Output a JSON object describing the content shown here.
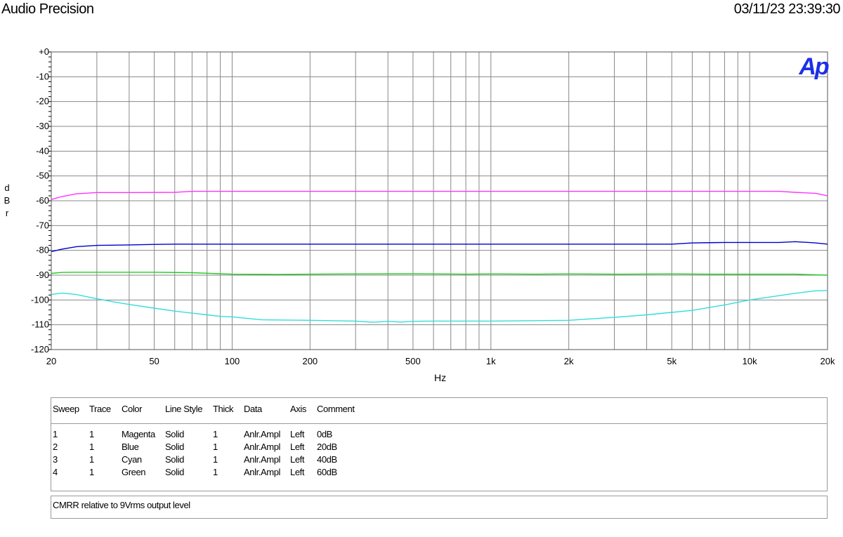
{
  "header": {
    "title": "Audio Precision",
    "timestamp": "03/11/23 23:39:30"
  },
  "logo": "Ap",
  "chart_data": {
    "type": "line",
    "xscale": "log",
    "xlim": [
      20,
      20000
    ],
    "ylim": [
      -120,
      0
    ],
    "ylabel": "dBr",
    "xlabel": "Hz",
    "grid": true,
    "y_ticks": [
      0,
      -10,
      -20,
      -30,
      -40,
      -50,
      -60,
      -70,
      -80,
      -90,
      -100,
      -110,
      -120
    ],
    "y_tick_labels": [
      "+0",
      "-10",
      "-20",
      "-30",
      "-40",
      "-50",
      "-60",
      "-70",
      "-80",
      "-90",
      "-100",
      "-110",
      "-120"
    ],
    "x_ticks": [
      20,
      50,
      100,
      200,
      500,
      1000,
      2000,
      5000,
      10000,
      20000
    ],
    "x_tick_labels": [
      "20",
      "50",
      "100",
      "200",
      "500",
      "1k",
      "2k",
      "5k",
      "10k",
      "20k"
    ],
    "series": [
      {
        "name": "0dB",
        "color": "#ff33ff",
        "x": [
          20,
          22,
          25,
          30,
          40,
          60,
          70,
          100,
          200,
          500,
          1000,
          2000,
          5000,
          10000,
          13000,
          15000,
          18000,
          20000
        ],
        "y": [
          -59.5,
          -58.3,
          -57.2,
          -56.7,
          -56.7,
          -56.6,
          -56.2,
          -56.2,
          -56.2,
          -56.2,
          -56.2,
          -56.2,
          -56.2,
          -56.2,
          -56.2,
          -56.6,
          -57.0,
          -58.0
        ]
      },
      {
        "name": "20dB",
        "color": "#0000cc",
        "x": [
          20,
          22,
          25,
          30,
          40,
          50,
          60,
          100,
          200,
          500,
          1000,
          2000,
          5000,
          6000,
          8000,
          10000,
          13000,
          15000,
          18000,
          20000
        ],
        "y": [
          -80.5,
          -79.5,
          -78.5,
          -78.0,
          -77.8,
          -77.6,
          -77.5,
          -77.5,
          -77.5,
          -77.5,
          -77.5,
          -77.5,
          -77.5,
          -77.0,
          -76.8,
          -76.8,
          -76.8,
          -76.5,
          -77.0,
          -77.5
        ]
      },
      {
        "name": "40dB",
        "color": "#33dddd",
        "x": [
          20,
          22,
          25,
          30,
          35,
          40,
          50,
          60,
          70,
          80,
          90,
          100,
          130,
          200,
          300,
          350,
          400,
          450,
          500,
          600,
          700,
          1000,
          2000,
          3000,
          4000,
          5000,
          6000,
          7000,
          8000,
          10000,
          12000,
          15000,
          18000,
          20000
        ],
        "y": [
          -97.8,
          -97.2,
          -97.8,
          -99.5,
          -100.8,
          -101.8,
          -103.3,
          -104.5,
          -105.3,
          -106.0,
          -106.6,
          -106.8,
          -108.0,
          -108.2,
          -108.5,
          -109.0,
          -108.6,
          -108.9,
          -108.6,
          -108.5,
          -108.5,
          -108.5,
          -108.2,
          -107.0,
          -106.0,
          -105.0,
          -104.2,
          -103.0,
          -102.0,
          -100.0,
          -98.8,
          -97.3,
          -96.3,
          -96.2
        ]
      },
      {
        "name": "60dB",
        "color": "#22cc22",
        "x": [
          20,
          22,
          25,
          30,
          50,
          70,
          100,
          150,
          200,
          300,
          500,
          800,
          1000,
          1500,
          2000,
          3000,
          5000,
          7000,
          10000,
          15000,
          20000
        ],
        "y": [
          -89.3,
          -88.9,
          -88.8,
          -88.8,
          -88.8,
          -89.0,
          -89.6,
          -89.7,
          -89.6,
          -89.5,
          -89.4,
          -89.6,
          -89.5,
          -89.6,
          -89.5,
          -89.6,
          -89.5,
          -89.6,
          -89.6,
          -89.6,
          -90.0
        ]
      }
    ]
  },
  "legend": {
    "headers": [
      "Sweep",
      "Trace",
      "Color",
      "Line Style",
      "Thick",
      "Data",
      "Axis",
      "Comment"
    ],
    "rows": [
      [
        "1",
        "1",
        "Magenta",
        "Solid",
        "1",
        "Anlr.Ampl",
        "Left",
        "0dB"
      ],
      [
        "2",
        "1",
        "Blue",
        "Solid",
        "1",
        "Anlr.Ampl",
        "Left",
        "20dB"
      ],
      [
        "3",
        "1",
        "Cyan",
        "Solid",
        "1",
        "Anlr.Ampl",
        "Left",
        "40dB"
      ],
      [
        "4",
        "1",
        "Green",
        "Solid",
        "1",
        "Anlr.Ampl",
        "Left",
        "60dB"
      ]
    ]
  },
  "comment": "CMRR relative to 9Vrms output level"
}
